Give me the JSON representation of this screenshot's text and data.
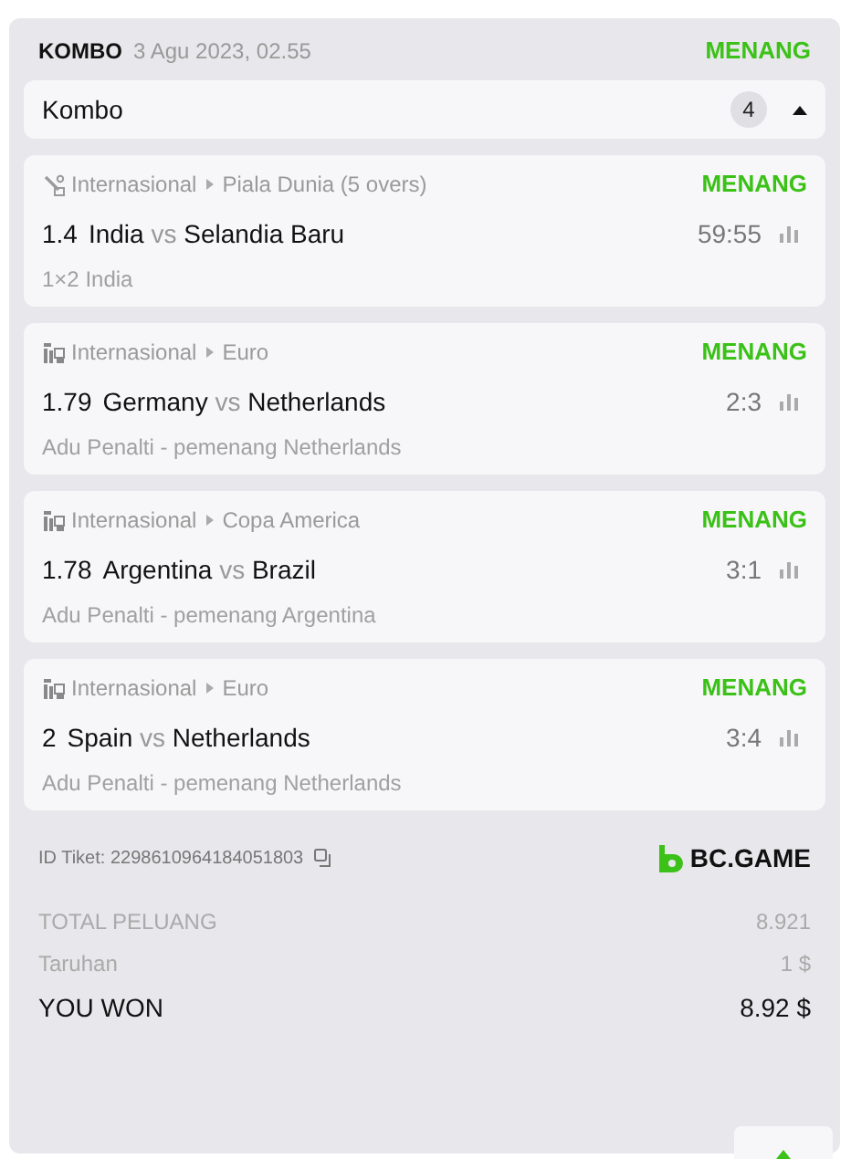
{
  "header": {
    "type": "KOMBO",
    "date": "3 Agu 2023, 02.55",
    "status": "MENANG"
  },
  "group": {
    "title": "Kombo",
    "count": "4",
    "expanded": true
  },
  "bets": [
    {
      "kind": "cricket",
      "category": "Internasional",
      "league": "Piala Dunia (5 overs)",
      "status": "MENANG",
      "odds": "1.4",
      "home": "India",
      "vs": "vs",
      "away": "Selandia Baru",
      "score": "59:55",
      "market": "1×2 India"
    },
    {
      "kind": "penalty",
      "category": "Internasional",
      "league": "Euro",
      "status": "MENANG",
      "odds": "1.79",
      "home": "Germany",
      "vs": "vs",
      "away": "Netherlands",
      "score": "2:3",
      "market": "Adu Penalti - pemenang Netherlands"
    },
    {
      "kind": "penalty",
      "category": "Internasional",
      "league": "Copa America",
      "status": "MENANG",
      "odds": "1.78",
      "home": "Argentina",
      "vs": "vs",
      "away": "Brazil",
      "score": "3:1",
      "market": "Adu Penalti - pemenang Argentina"
    },
    {
      "kind": "penalty",
      "category": "Internasional",
      "league": "Euro",
      "status": "MENANG",
      "odds": "2",
      "home": "Spain",
      "vs": "vs",
      "away": "Netherlands",
      "score": "3:4",
      "market": "Adu Penalti - pemenang Netherlands"
    }
  ],
  "ticket": {
    "label": "ID Tiket: 2298610964184051803",
    "brand": "BC.GAME"
  },
  "totals": [
    {
      "kind": "muted",
      "label": "TOTAL PELUANG",
      "value": "8.921"
    },
    {
      "kind": "muted",
      "label": "Taruhan",
      "value": "1 $"
    },
    {
      "kind": "strong",
      "label": "YOU WON",
      "value": "8.92 $"
    }
  ]
}
